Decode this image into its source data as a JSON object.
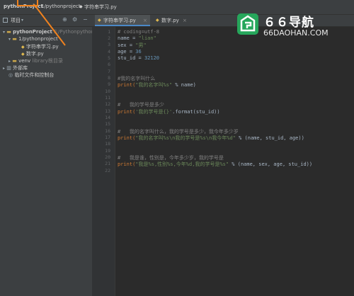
{
  "topbar": {
    "project": "pythonProject",
    "folder": "1/pythonproject",
    "file": "字符串学习.py"
  },
  "toolbar": {
    "project_label": "项目",
    "gear": "⚙",
    "minus": "−"
  },
  "tabs": [
    {
      "label": "字符串学习.py",
      "close": "×"
    },
    {
      "label": "数字.py",
      "close": "×"
    }
  ],
  "tree": {
    "root": "pythonProject",
    "root_path": "F:/PythonpythonPro",
    "folder": "1/pythonproject",
    "files": [
      "字符串学习.py",
      "数字.py"
    ],
    "venv": "venv",
    "venv_note": "library根目录",
    "external": "外部库",
    "scratch": "临时文件和控制台"
  },
  "gutter": {
    "line_numbers": [
      "1",
      "2",
      "3",
      "4",
      "5",
      "6",
      "7",
      "8",
      "9",
      "10",
      "11",
      "12",
      "13",
      "14",
      "15",
      "16",
      "17",
      "18",
      "19",
      "20",
      "21",
      "22"
    ]
  },
  "code": {
    "l1": "# coding=utf-8",
    "l2_var": "name = ",
    "l2_val": "\"lian\"",
    "l3_var": "sex = ",
    "l3_val": "\"男\"",
    "l4_var": "age = ",
    "l4_val": "36",
    "l5_var": "stu_id = ",
    "l5_val": "32120",
    "l7": "#我的名字叫什么",
    "l8_fn": "print(",
    "l8_str": "\"我的名字叫%s\"",
    "l8_tail": " % name)",
    "l10": "#   我的学号是多少",
    "l11_fn": "print(",
    "l11_str": "'我的学号是{}'",
    "l11_tail": ".format(stu_id))",
    "l13": "#   我的名字叫什么，我的学号是多少，我今年多少岁",
    "l14_fn": "print(",
    "l14_str": "\"我的名字叫%s\\n我的学号是%s\\n我今年%d\"",
    "l14_tail": " % (name, stu_id, age))",
    "l16": "#   我是谁，性别是，今年多少岁，我的学号是",
    "l17_fn": "print(",
    "l17_str": "\"我是%s,性别%s,今年%d,我的学号是%s\"",
    "l17_tail": " % (name, sex, age, stu_id))"
  },
  "watermark": {
    "title": "６６导航",
    "url": "66DAOHAN.COM"
  },
  "colors": {
    "accent": "#4a88c7",
    "annotation": "#f0821e",
    "logo_green": "#26a65b"
  }
}
